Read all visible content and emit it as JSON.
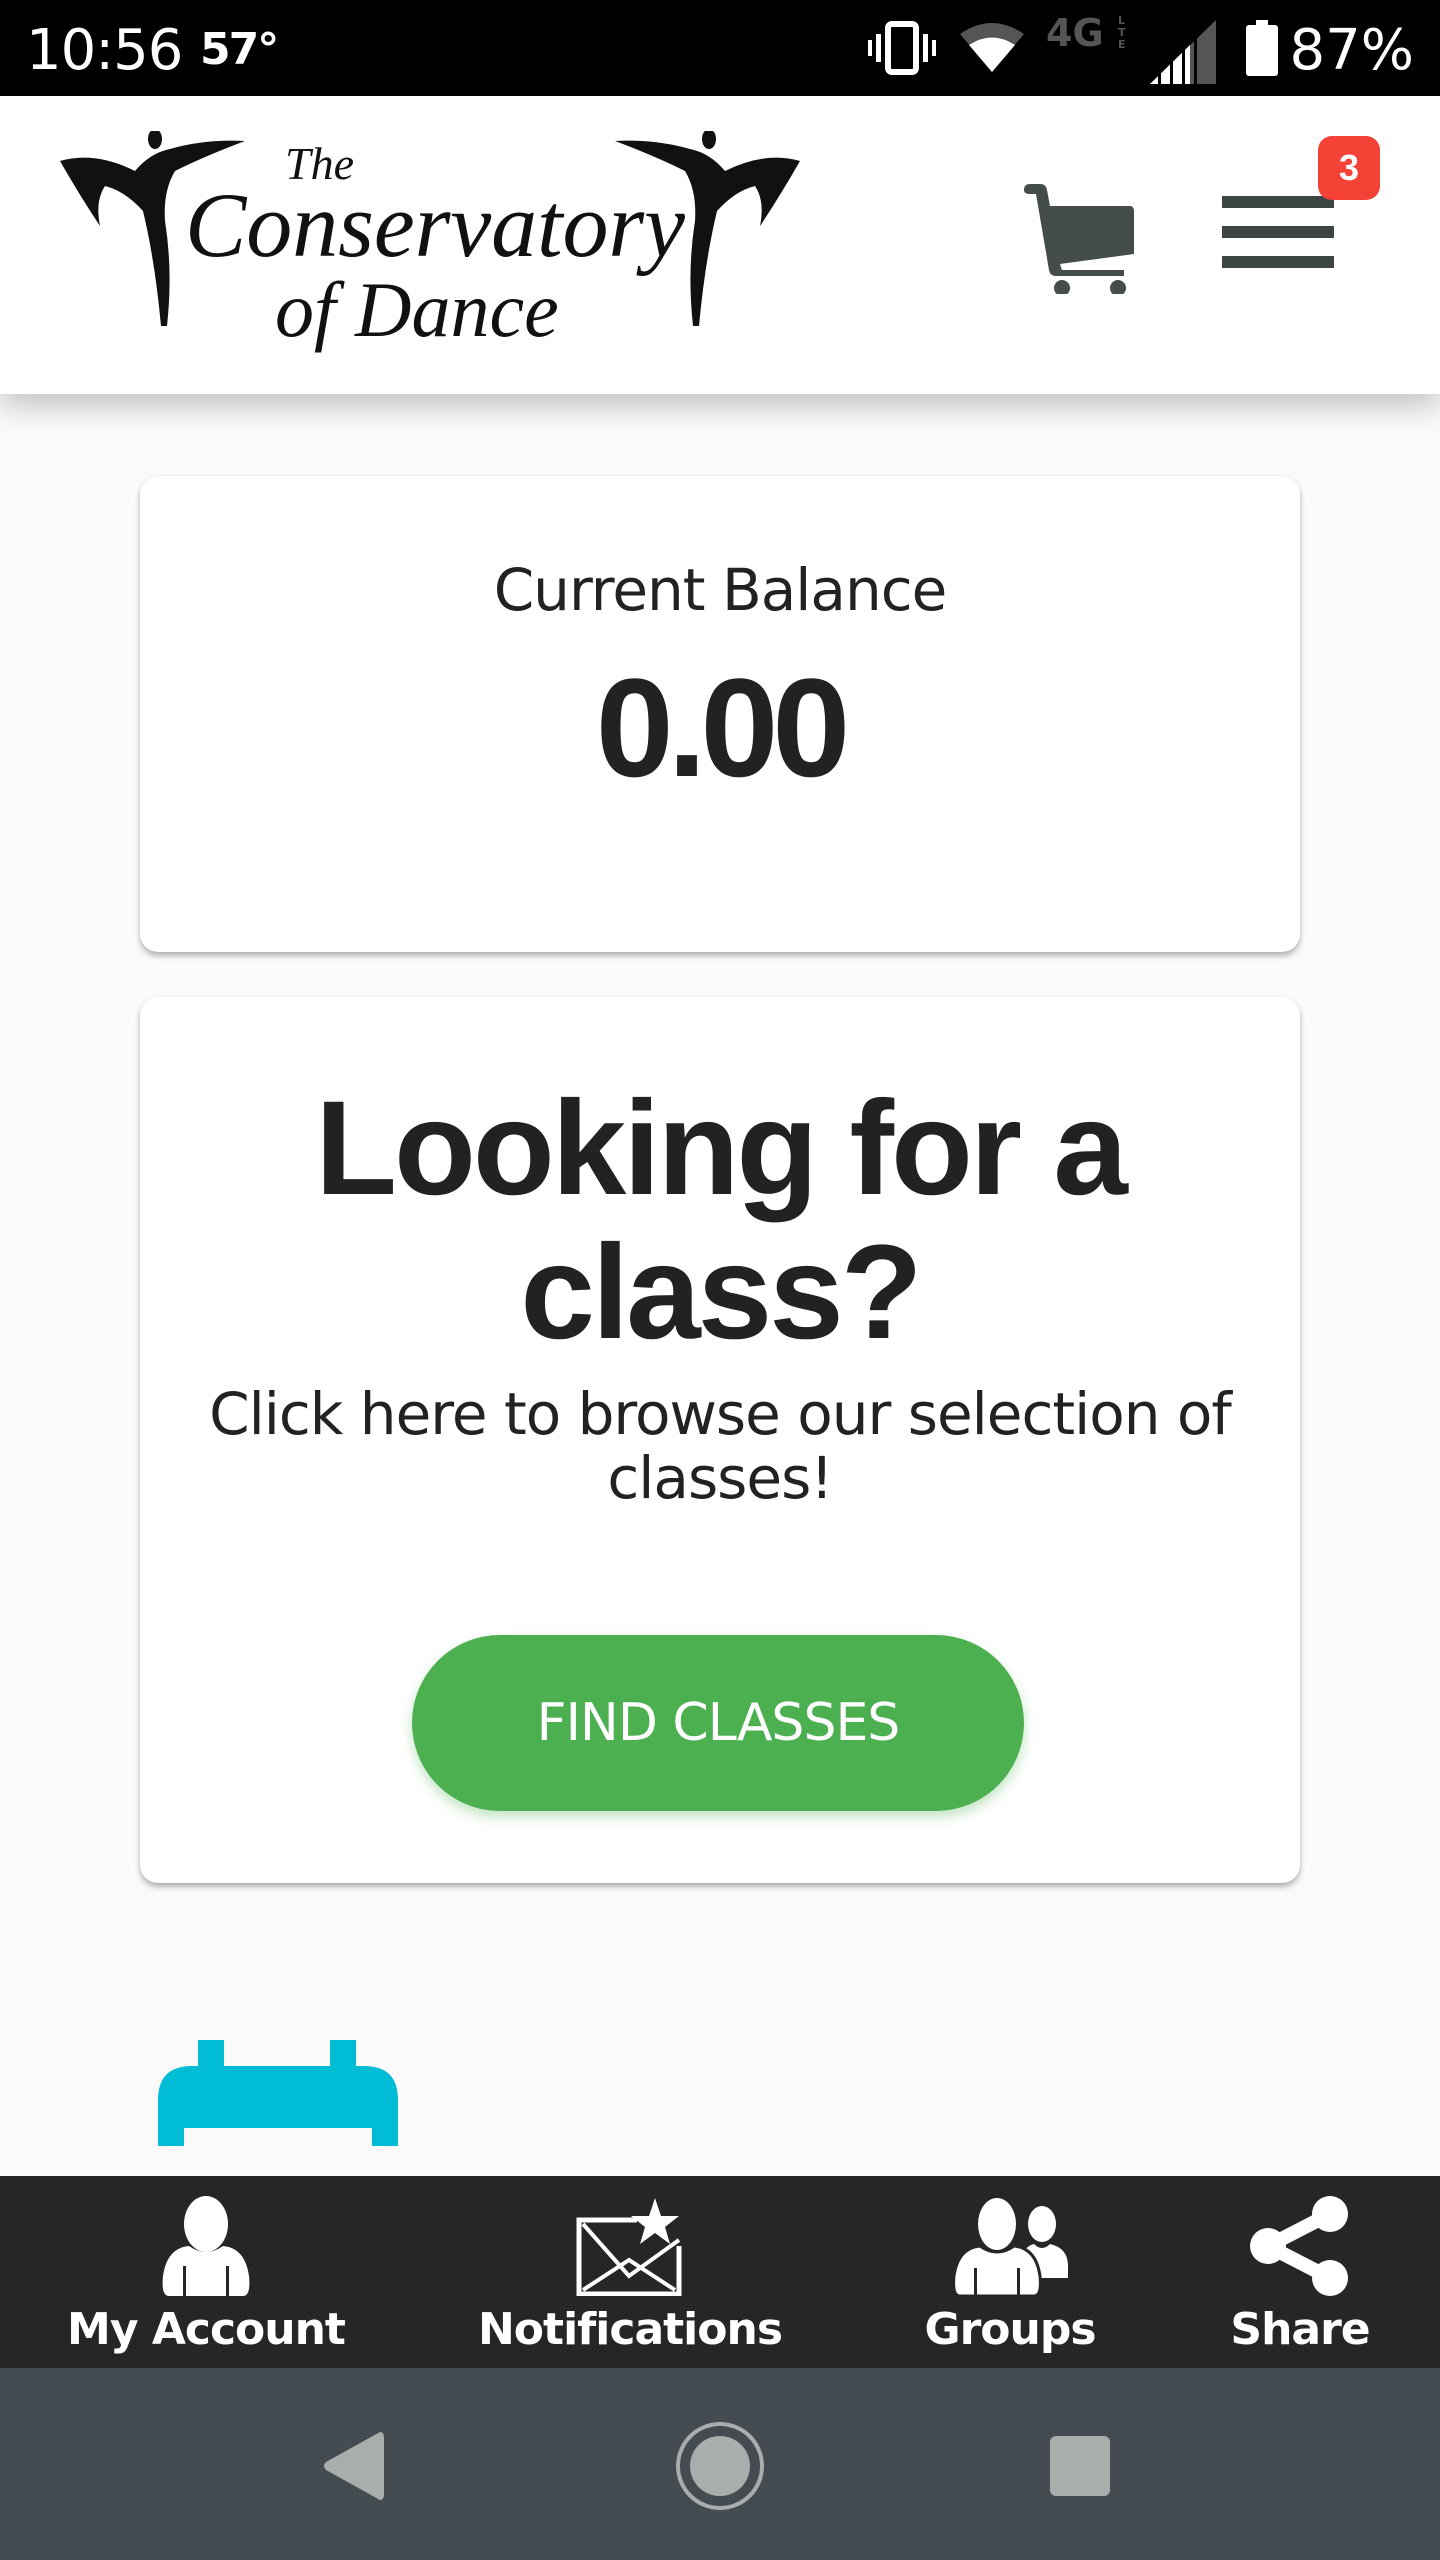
{
  "status_bar": {
    "time": "10:56",
    "temperature": "57°",
    "battery_percent": "87%",
    "icons": [
      "vibrate-icon",
      "wifi-icon",
      "4g-lte-icon",
      "signal-icon",
      "battery-icon"
    ]
  },
  "header": {
    "logo_text_line1": "The",
    "logo_text_line2": "Conservatory",
    "logo_text_line3": "of Dance",
    "cart_icon": "shopping-cart-icon",
    "menu_icon": "hamburger-menu-icon",
    "menu_badge_count": "3"
  },
  "balance_card": {
    "label": "Current Balance",
    "value": "0.00"
  },
  "class_card": {
    "title": "Looking for a class?",
    "description": "Click here to browse our selection of classes!",
    "button_label": "FIND CLASSES"
  },
  "partial_icon": "calendar-icon",
  "bottom_nav": {
    "items": [
      {
        "label": "My Account",
        "icon": "user-icon"
      },
      {
        "label": "Notifications",
        "icon": "envelope-star-icon"
      },
      {
        "label": "Groups",
        "icon": "users-icon"
      },
      {
        "label": "Share",
        "icon": "share-icon"
      }
    ]
  },
  "android_nav": {
    "buttons": [
      "back",
      "home",
      "recents"
    ]
  },
  "colors": {
    "accent_green": "#4caf50",
    "badge_red": "#f44336",
    "calendar_cyan": "#00bcd4",
    "nav_dark": "#262626",
    "android_nav": "#454c51",
    "icon_gray": "#3d4544"
  }
}
